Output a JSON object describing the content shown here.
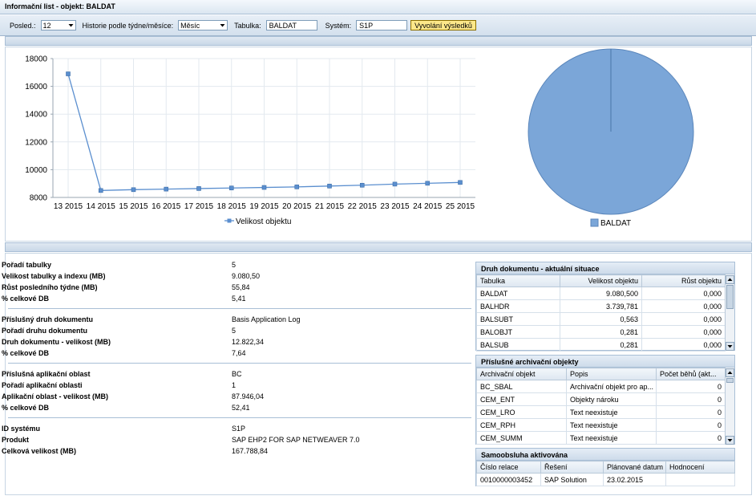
{
  "window": {
    "title": "Informační list - objekt: BALDAT"
  },
  "toolbar": {
    "posled_label": "Posled.:",
    "posled_value": "12",
    "history_label": "Historie podle týdne/měsíce:",
    "history_value": "Měsíc",
    "table_label": "Tabulka:",
    "table_value": "BALDAT",
    "system_label": "Systém:",
    "system_value": "S1P",
    "button_label": "Vyvolání výsledků"
  },
  "chart_data": [
    {
      "type": "line",
      "categories": [
        "13 2015",
        "14 2015",
        "15 2015",
        "16 2015",
        "17 2015",
        "18 2015",
        "19 2015",
        "20 2015",
        "21 2015",
        "22 2015",
        "23 2015",
        "24 2015",
        "25 2015"
      ],
      "series": [
        {
          "name": "Velikost objektu",
          "values": [
            16900,
            8500,
            8560,
            8600,
            8640,
            8680,
            8720,
            8760,
            8820,
            8880,
            8960,
            9020,
            9080
          ]
        }
      ],
      "y_ticks": [
        "18000",
        "16000",
        "14000",
        "12000",
        "10000",
        "8000"
      ],
      "ylim": [
        8000,
        18000
      ],
      "grid": true,
      "legend": "bottom",
      "color": "#5b8fcf"
    },
    {
      "type": "pie",
      "categories": [
        "BALDAT"
      ],
      "values": [
        100
      ],
      "legend": "bottom",
      "color": "#7ba6d8"
    }
  ],
  "info": {
    "groups": [
      [
        {
          "k": "Pořadí tabulky",
          "v": "5"
        },
        {
          "k": "Velikost tabulky a indexu (MB)",
          "v": "9.080,50"
        },
        {
          "k": "Růst posledního týdne (MB)",
          "v": "55,84"
        },
        {
          "k": "% celkové DB",
          "v": "5,41"
        }
      ],
      [
        {
          "k": "Příslušný druh dokumentu",
          "v": "Basis Application Log"
        },
        {
          "k": "Pořadí druhu dokumentu",
          "v": "5"
        },
        {
          "k": "Druh dokumentu - velikost (MB)",
          "v": "12.822,34"
        },
        {
          "k": "% celkové DB",
          "v": "7,64"
        }
      ],
      [
        {
          "k": "Příslušná aplikační oblast",
          "v": "BC"
        },
        {
          "k": "Pořadí aplikační oblasti",
          "v": "1"
        },
        {
          "k": "Aplikační oblast - velikost (MB)",
          "v": "87.946,04"
        },
        {
          "k": "% celkové DB",
          "v": "52,41"
        }
      ],
      [
        {
          "k": "ID systému",
          "v": "S1P"
        },
        {
          "k": "Produkt",
          "v": "SAP EHP2 FOR SAP NETWEAVER 7.0"
        },
        {
          "k": "Celková velikost (MB)",
          "v": "167.788,84"
        }
      ]
    ]
  },
  "doc_types": {
    "title": "Druh dokumentu - aktuální situace",
    "columns": [
      "Tabulka",
      "Velikost objektu",
      "Růst objektu"
    ],
    "rows": [
      [
        "BALDAT",
        "9.080,500",
        "0,000"
      ],
      [
        "BALHDR",
        "3.739,781",
        "0,000"
      ],
      [
        "BALSUBT",
        "0,563",
        "0,000"
      ],
      [
        "BALOBJT",
        "0,281",
        "0,000"
      ],
      [
        "BALSUB",
        "0,281",
        "0,000"
      ]
    ]
  },
  "archive": {
    "title": "Příslušné archivační objekty",
    "columns": [
      "Archivační objekt",
      "Popis",
      "Počet běhů (akt..."
    ],
    "rows": [
      [
        "BC_SBAL",
        "Archivační objekt pro ap...",
        "0"
      ],
      [
        "CEM_ENT",
        "Objekty nároku",
        "0"
      ],
      [
        "CEM_LRO",
        "Text neexistuje",
        "0"
      ],
      [
        "CEM_RPH",
        "Text neexistuje",
        "0"
      ],
      [
        "CEM_SUMM",
        "Text neexistuje",
        "0"
      ]
    ]
  },
  "selfservice": {
    "title": "Samoobsluha aktivována",
    "columns": [
      "Číslo relace",
      "Řešení",
      "Plánované datum",
      "Hodnocení"
    ],
    "rows": [
      [
        "0010000003452",
        "SAP Solution",
        "23.02.2015",
        ""
      ]
    ]
  }
}
